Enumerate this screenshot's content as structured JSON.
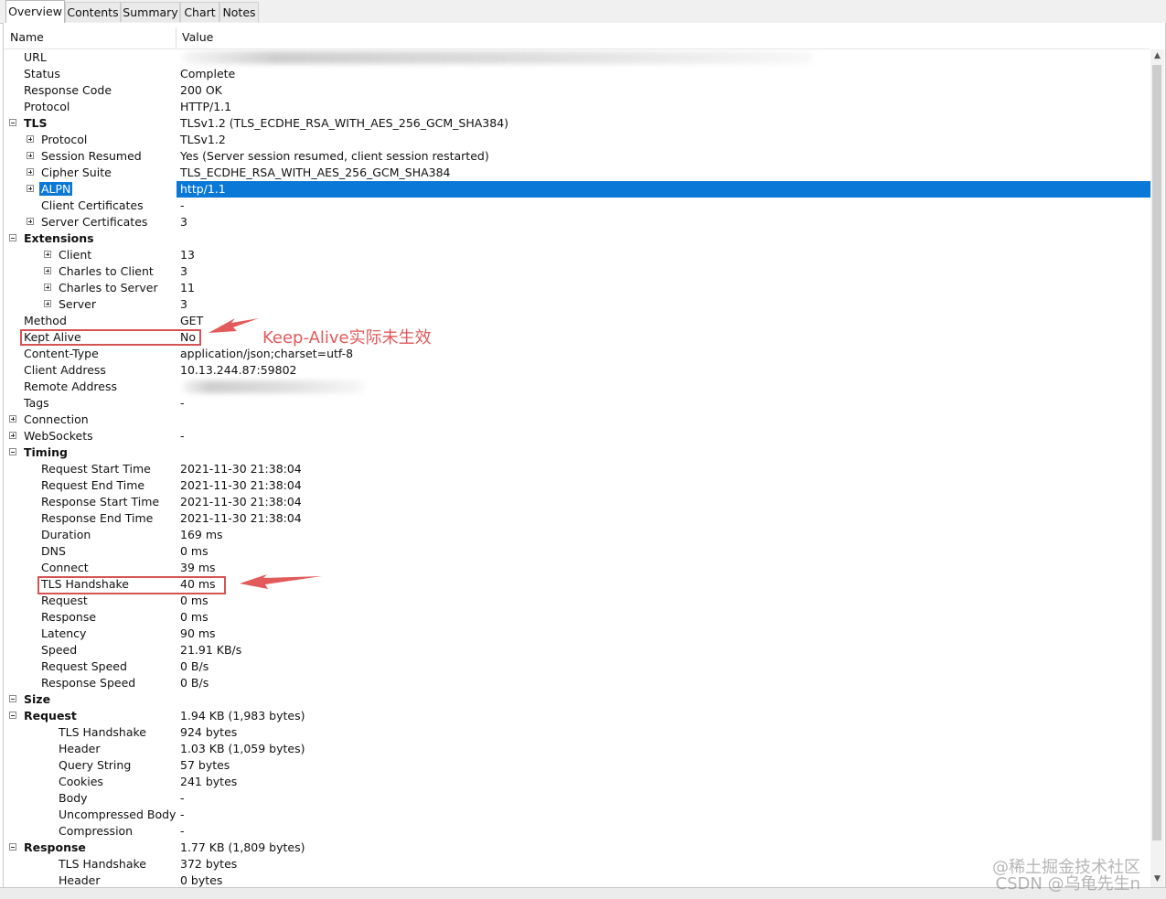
{
  "tabs": [
    {
      "label": "Overview",
      "active": true
    },
    {
      "label": "Contents",
      "active": false
    },
    {
      "label": "Summary",
      "active": false
    },
    {
      "label": "Chart",
      "active": false
    },
    {
      "label": "Notes",
      "active": false
    }
  ],
  "columns": {
    "name": "Name",
    "value": "Value"
  },
  "rows": [
    {
      "name": "URL",
      "value": "",
      "depth": 1,
      "toggle": "none"
    },
    {
      "name": "Status",
      "value": "Complete",
      "depth": 1,
      "toggle": "none"
    },
    {
      "name": "Response Code",
      "value": "200 OK",
      "depth": 1,
      "toggle": "none"
    },
    {
      "name": "Protocol",
      "value": "HTTP/1.1",
      "depth": 1,
      "toggle": "none"
    },
    {
      "name": "TLS",
      "value": "TLSv1.2 (TLS_ECDHE_RSA_WITH_AES_256_GCM_SHA384)",
      "depth": 0,
      "toggle": "minus",
      "bold": true
    },
    {
      "name": "Protocol",
      "value": "TLSv1.2",
      "depth": 2,
      "toggle": "plus"
    },
    {
      "name": "Session Resumed",
      "value": "Yes (Server session resumed, client session restarted)",
      "depth": 2,
      "toggle": "plus"
    },
    {
      "name": "Cipher Suite",
      "value": "TLS_ECDHE_RSA_WITH_AES_256_GCM_SHA384",
      "depth": 2,
      "toggle": "plus"
    },
    {
      "name": "ALPN",
      "value": "http/1.1",
      "depth": 2,
      "toggle": "plus",
      "selected": true
    },
    {
      "name": "Client Certificates",
      "value": "-",
      "depth": 2,
      "toggle": "none"
    },
    {
      "name": "Server Certificates",
      "value": "3",
      "depth": 2,
      "toggle": "plus"
    },
    {
      "name": "Extensions",
      "value": "",
      "depth": 1,
      "toggle": "minus",
      "bold": true
    },
    {
      "name": "Client",
      "value": "13",
      "depth": 3,
      "toggle": "plus"
    },
    {
      "name": "Charles to Client",
      "value": "3",
      "depth": 3,
      "toggle": "plus"
    },
    {
      "name": "Charles to Server",
      "value": "11",
      "depth": 3,
      "toggle": "plus"
    },
    {
      "name": "Server",
      "value": "3",
      "depth": 3,
      "toggle": "plus"
    },
    {
      "name": "Method",
      "value": "GET",
      "depth": 1,
      "toggle": "none"
    },
    {
      "name": "Kept Alive",
      "value": "No",
      "depth": 1,
      "toggle": "none"
    },
    {
      "name": "Content-Type",
      "value": "application/json;charset=utf-8",
      "depth": 1,
      "toggle": "none"
    },
    {
      "name": "Client Address",
      "value": "10.13.244.87:59802",
      "depth": 1,
      "toggle": "none"
    },
    {
      "name": "Remote Address",
      "value": "",
      "depth": 1,
      "toggle": "none"
    },
    {
      "name": "Tags",
      "value": "-",
      "depth": 1,
      "toggle": "none"
    },
    {
      "name": "Connection",
      "value": "",
      "depth": 0,
      "toggle": "plus"
    },
    {
      "name": "WebSockets",
      "value": "-",
      "depth": 0,
      "toggle": "plus"
    },
    {
      "name": "Timing",
      "value": "",
      "depth": 0,
      "toggle": "minus",
      "bold": true
    },
    {
      "name": "Request Start Time",
      "value": "2021-11-30 21:38:04",
      "depth": 2,
      "toggle": "none"
    },
    {
      "name": "Request End Time",
      "value": "2021-11-30 21:38:04",
      "depth": 2,
      "toggle": "none"
    },
    {
      "name": "Response Start Time",
      "value": "2021-11-30 21:38:04",
      "depth": 2,
      "toggle": "none"
    },
    {
      "name": "Response End Time",
      "value": "2021-11-30 21:38:04",
      "depth": 2,
      "toggle": "none"
    },
    {
      "name": "Duration",
      "value": "169 ms",
      "depth": 2,
      "toggle": "none"
    },
    {
      "name": "DNS",
      "value": "0 ms",
      "depth": 2,
      "toggle": "none"
    },
    {
      "name": "Connect",
      "value": "39 ms",
      "depth": 2,
      "toggle": "none"
    },
    {
      "name": "TLS Handshake",
      "value": "40 ms",
      "depth": 2,
      "toggle": "none"
    },
    {
      "name": "Request",
      "value": "0 ms",
      "depth": 2,
      "toggle": "none"
    },
    {
      "name": "Response",
      "value": "0 ms",
      "depth": 2,
      "toggle": "none"
    },
    {
      "name": "Latency",
      "value": "90 ms",
      "depth": 2,
      "toggle": "none"
    },
    {
      "name": "Speed",
      "value": "21.91 KB/s",
      "depth": 2,
      "toggle": "none"
    },
    {
      "name": "Request Speed",
      "value": "0 B/s",
      "depth": 2,
      "toggle": "none"
    },
    {
      "name": "Response Speed",
      "value": "0 B/s",
      "depth": 2,
      "toggle": "none"
    },
    {
      "name": "Size",
      "value": "",
      "depth": 0,
      "toggle": "minus",
      "bold": true
    },
    {
      "name": "Request",
      "value": "1.94 KB (1,983 bytes)",
      "depth": 1,
      "toggle": "minus",
      "bold": true
    },
    {
      "name": "TLS Handshake",
      "value": "924 bytes",
      "depth": 3,
      "toggle": "none"
    },
    {
      "name": "Header",
      "value": "1.03 KB (1,059 bytes)",
      "depth": 3,
      "toggle": "none"
    },
    {
      "name": "Query String",
      "value": "57 bytes",
      "depth": 3,
      "toggle": "none"
    },
    {
      "name": "Cookies",
      "value": "241 bytes",
      "depth": 3,
      "toggle": "none"
    },
    {
      "name": "Body",
      "value": "-",
      "depth": 3,
      "toggle": "none"
    },
    {
      "name": "Uncompressed Body",
      "value": "-",
      "depth": 3,
      "toggle": "none"
    },
    {
      "name": "Compression",
      "value": "-",
      "depth": 3,
      "toggle": "none"
    },
    {
      "name": "Response",
      "value": "1.77 KB (1,809 bytes)",
      "depth": 1,
      "toggle": "minus",
      "bold": true
    },
    {
      "name": "TLS Handshake",
      "value": "372 bytes",
      "depth": 3,
      "toggle": "none"
    },
    {
      "name": "Header",
      "value": "0 bytes",
      "depth": 3,
      "toggle": "none"
    }
  ],
  "annotation": {
    "text": "Keep-Alive实际未生效",
    "color": "#e25a5a"
  },
  "watermark": {
    "line1": "@稀土掘金技术社区",
    "line2": "CSDN @乌龟先生n"
  },
  "colors": {
    "selection": "#0a78d7",
    "annotation_red": "#d65353"
  }
}
